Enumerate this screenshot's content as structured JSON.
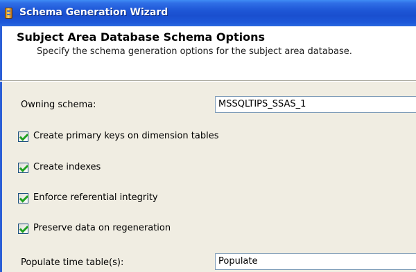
{
  "window": {
    "title": "Schema Generation Wizard"
  },
  "header": {
    "title": "Subject Area Database Schema Options",
    "subtitle": "Specify the schema generation options for the subject area database."
  },
  "owning_schema": {
    "label": "Owning schema:",
    "value": "MSSQLTIPS_SSAS_1"
  },
  "options": [
    {
      "label": "Create primary keys on dimension tables",
      "checked": true
    },
    {
      "label": "Create indexes",
      "checked": true
    },
    {
      "label": "Enforce referential integrity",
      "checked": true
    },
    {
      "label": "Preserve data on regeneration",
      "checked": true
    }
  ],
  "populate_time_tables": {
    "label": "Populate time table(s):",
    "value": "Populate"
  }
}
